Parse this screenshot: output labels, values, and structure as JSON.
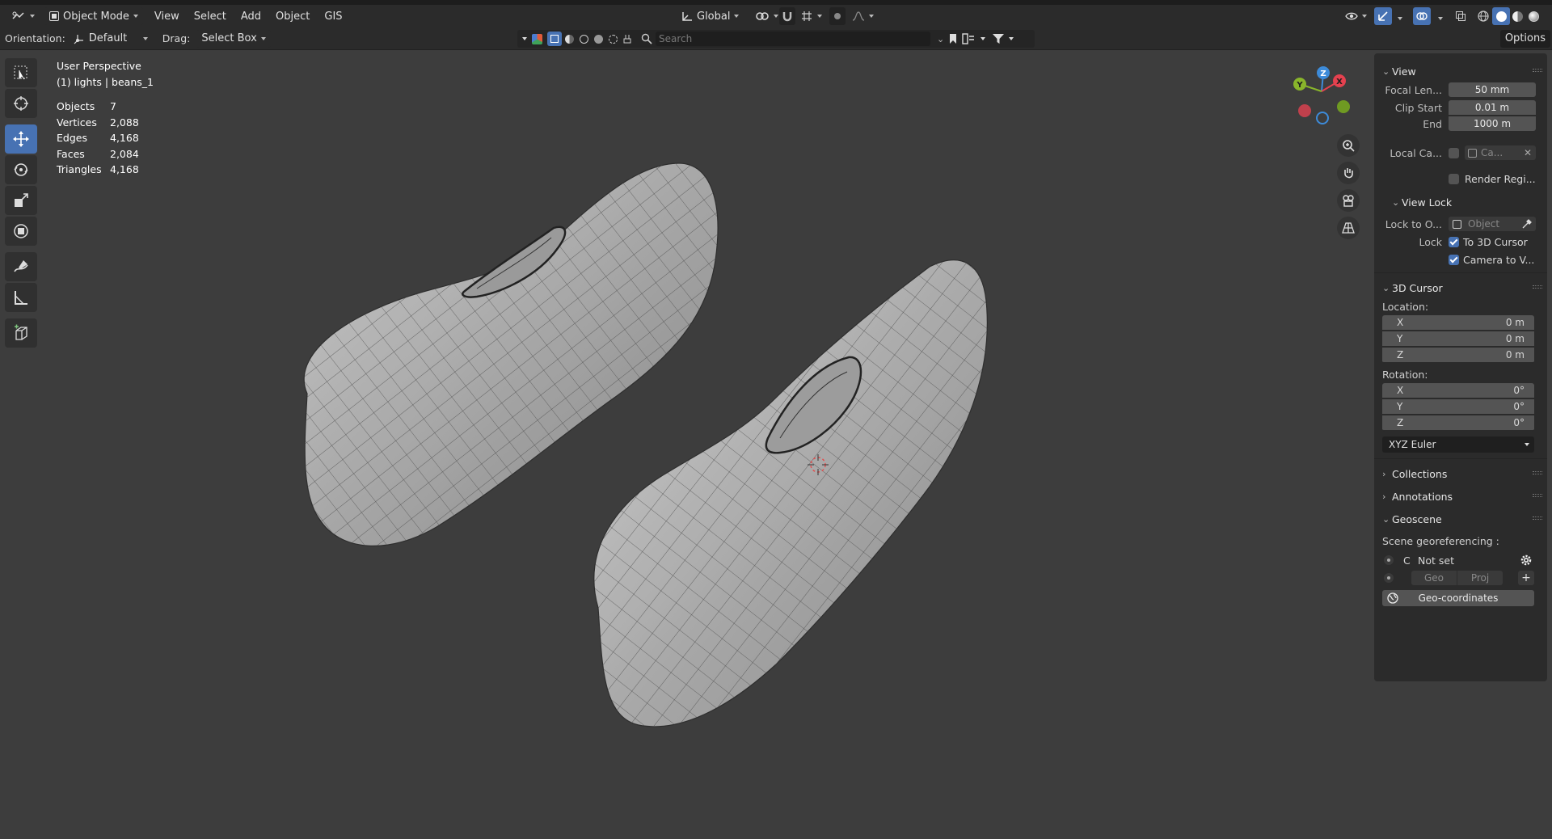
{
  "header": {
    "mode_label": "Object Mode",
    "menus": [
      "View",
      "Select",
      "Add",
      "Object",
      "GIS"
    ],
    "transform_orientation": "Global"
  },
  "tool_header": {
    "orientation_label": "Orientation:",
    "orientation_value": "Default",
    "drag_label": "Drag:",
    "drag_value": "Select Box",
    "search_placeholder": "Search",
    "options_label": "Options"
  },
  "overlay": {
    "view_name": "User Perspective",
    "context": "(1) lights | beans_1",
    "stats": [
      {
        "label": "Objects",
        "value": "7"
      },
      {
        "label": "Vertices",
        "value": "2,088"
      },
      {
        "label": "Edges",
        "value": "4,168"
      },
      {
        "label": "Faces",
        "value": "2,084"
      },
      {
        "label": "Triangles",
        "value": "4,168"
      }
    ]
  },
  "gizmo": {
    "x": "X",
    "y": "Y",
    "z": "Z"
  },
  "sidebar": {
    "view": {
      "title": "View",
      "focal_label": "Focal Len...",
      "focal_value": "50 mm",
      "clip_start_label": "Clip Start",
      "clip_start_value": "0.01 m",
      "clip_end_label": "End",
      "clip_end_value": "1000 m",
      "local_camera_label": "Local Ca...",
      "local_camera_value": "Ca...",
      "render_region_label": "Render Regi..."
    },
    "view_lock": {
      "title": "View Lock",
      "lock_object_label": "Lock to O...",
      "lock_object_placeholder": "Object",
      "lock_label": "Lock",
      "to_cursor": "To 3D Cursor",
      "camera_to_view": "Camera to V..."
    },
    "cursor": {
      "title": "3D Cursor",
      "location_label": "Location:",
      "location": [
        {
          "axis": "X",
          "value": "0 m"
        },
        {
          "axis": "Y",
          "value": "0 m"
        },
        {
          "axis": "Z",
          "value": "0 m"
        }
      ],
      "rotation_label": "Rotation:",
      "rotation": [
        {
          "axis": "X",
          "value": "0°"
        },
        {
          "axis": "Y",
          "value": "0°"
        },
        {
          "axis": "Z",
          "value": "0°"
        }
      ],
      "rotation_mode": "XYZ Euler"
    },
    "collections_title": "Collections",
    "annotations_title": "Annotations",
    "geoscene": {
      "title": "Geoscene",
      "scene_label": "Scene georeferencing :",
      "crs_letter": "C",
      "status": "Not set",
      "geo_btn": "Geo",
      "proj_btn": "Proj",
      "geocoords_btn": "Geo-coordinates"
    }
  },
  "colors": {
    "accent": "#4772b3",
    "viewport": "#3d3d3d",
    "panel": "#2b2b2b",
    "axis_x": "#e5414f",
    "axis_y": "#89b52b",
    "axis_z": "#3d8bd9"
  }
}
